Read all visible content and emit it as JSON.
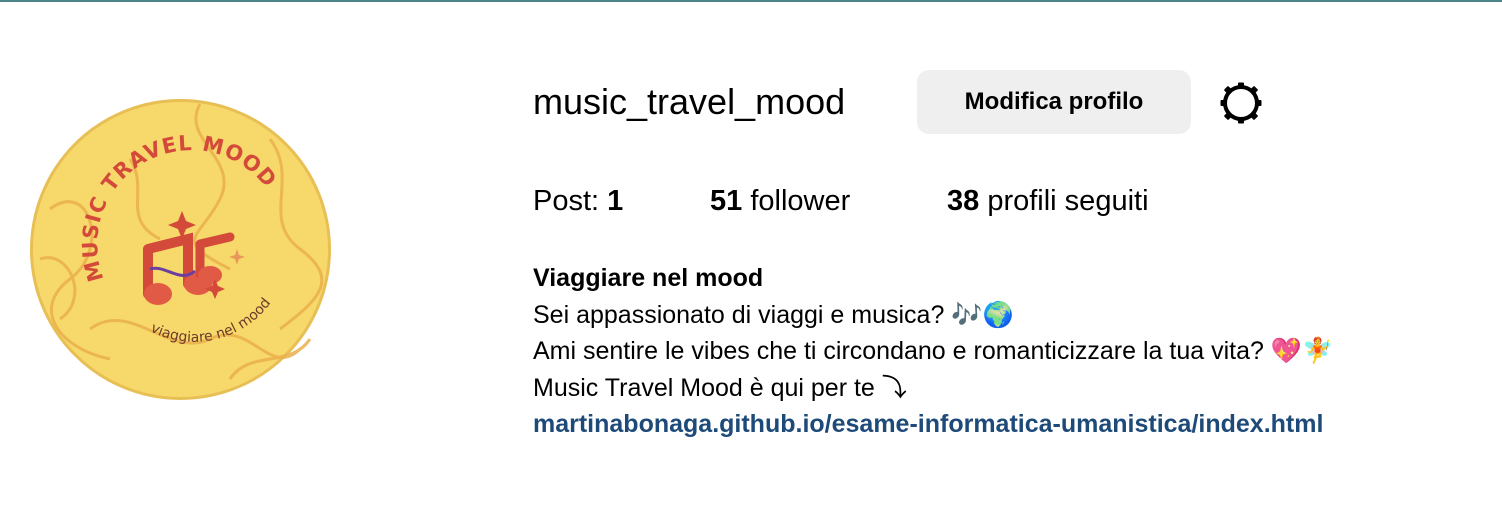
{
  "profile": {
    "username": "music_travel_mood",
    "edit_button": "Modifica profilo",
    "settings_icon": "gear-icon",
    "avatar_icon": "music-travel-mood-logo",
    "avatar": {
      "logo_text": "MUSIC TRAVEL MOOD",
      "tagline": "viaggiare nel mood"
    }
  },
  "stats": {
    "posts_label": "Post:",
    "posts_value": "1",
    "followers_value": "51",
    "followers_label": "follower",
    "following_value": "38",
    "following_label": "profili seguiti"
  },
  "bio": {
    "title": "Viaggiare nel mood",
    "line1": "Sei appassionato di viaggi e musica? 🎶🌍",
    "line2": "Ami sentire le vibes che ti circondano e romanticizzare la tua vita? 💖🧚",
    "line3": "Music Travel Mood è qui per te ⤵",
    "link": "martinabonaga.github.io/esame-informatica-umanistica/index.html"
  },
  "colors": {
    "accent_link": "#1e4a79",
    "button_bg": "#efefef",
    "logo_yellow": "#f7d86a",
    "logo_red": "#d44a3a",
    "top_border": "#4f8488"
  }
}
